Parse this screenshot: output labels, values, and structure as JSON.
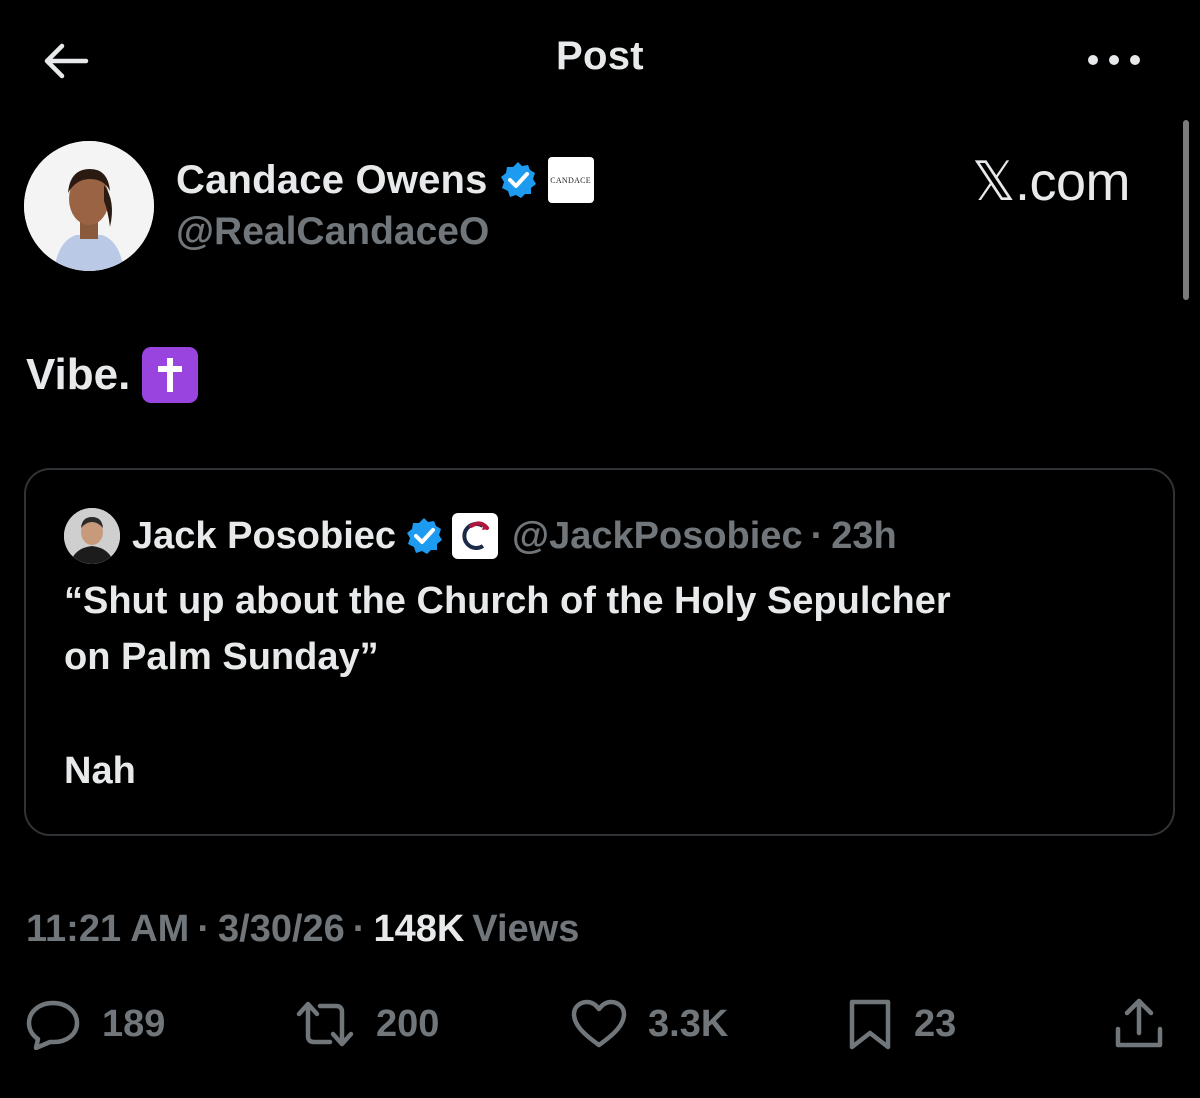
{
  "header": {
    "title": "Post"
  },
  "author": {
    "name": "Candace Owens",
    "handle": "@RealCandaceO",
    "affiliate_badge": "CANDACE"
  },
  "watermark": "𝕏.com",
  "post": {
    "text": "Vibe."
  },
  "quote": {
    "name": "Jack Posobiec",
    "handle": "@JackPosobiec",
    "separator": "·",
    "time": "23h",
    "line1": "“Shut up about the Church of the Holy Sepulcher",
    "line2": "on Palm Sunday”",
    "line3": "Nah"
  },
  "meta": {
    "time": "11:21 AM",
    "sep1": "·",
    "date": "3/30/26",
    "sep2": "·",
    "views_count": "148K",
    "views_label": "Views"
  },
  "actions": {
    "replies": "189",
    "reposts": "200",
    "likes": "3.3K",
    "bookmarks": "23"
  },
  "colors": {
    "background": "#000000",
    "text": "#e7e9ea",
    "muted": "#71767b",
    "verified": "#1d9bf0",
    "border": "#2f3336",
    "emoji_bg": "#9a44e0"
  },
  "icons": {
    "back": "arrow-left-icon",
    "more": "more-horizontal-icon",
    "verified": "verified-badge-icon",
    "emoji": "latin-cross-emoji",
    "reply": "reply-icon",
    "repost": "repost-icon",
    "like": "heart-icon",
    "bookmark": "bookmark-icon",
    "share": "share-icon"
  }
}
